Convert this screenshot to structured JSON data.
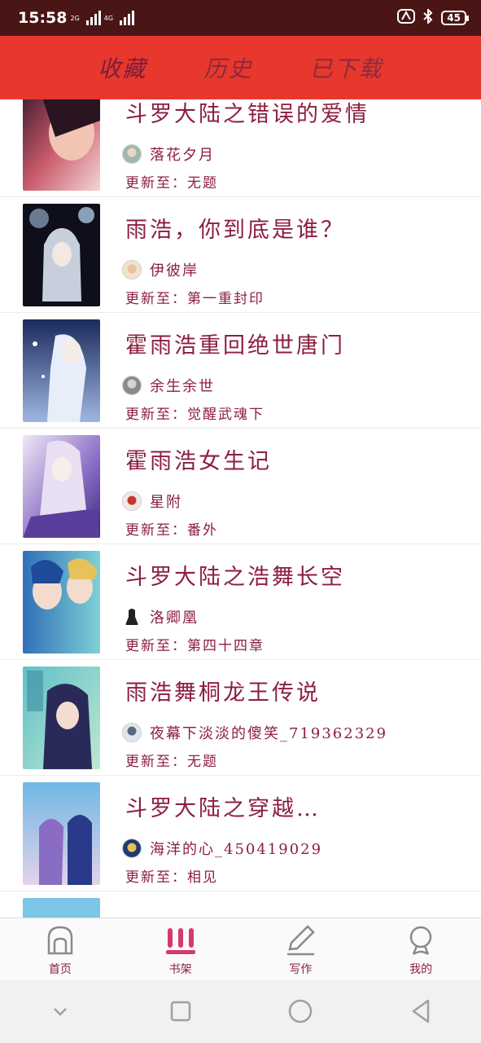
{
  "status_bar": {
    "time": "15:58",
    "network_label_1": "2G",
    "network_label_2": "4G",
    "battery": "45"
  },
  "header": {
    "tabs": [
      {
        "label": "收藏",
        "active": true
      },
      {
        "label": "历史",
        "active": false
      },
      {
        "label": "已下载",
        "active": false
      }
    ]
  },
  "books": [
    {
      "title": "斗罗大陆之错误的爱情",
      "author": "落花夕月",
      "update": "更新至：无题"
    },
    {
      "title": "雨浩，你到底是谁？",
      "author": "伊彼岸",
      "update": "更新至：第一重封印"
    },
    {
      "title": "霍雨浩重回绝世唐门",
      "author": "余生余世",
      "update": "更新至：觉醒武魂下"
    },
    {
      "title": "霍雨浩女生记",
      "author": "星附",
      "update": "更新至：番外"
    },
    {
      "title": "斗罗大陆之浩舞长空",
      "author": "洛卿凰",
      "update": "更新至：第四十四章"
    },
    {
      "title": "雨浩舞桐龙王传说",
      "author": "夜幕下淡淡的傻笑_719362329",
      "update": "更新至：无题"
    },
    {
      "title": "斗罗大陆之穿越…",
      "author": "海洋的心_450419029",
      "update": "更新至：相见"
    }
  ],
  "bottom_nav": [
    {
      "label": "首页",
      "icon": "home-icon"
    },
    {
      "label": "书架",
      "icon": "bookshelf-icon"
    },
    {
      "label": "写作",
      "icon": "pen-icon"
    },
    {
      "label": "我的",
      "icon": "profile-icon"
    }
  ],
  "colors": {
    "header": "#e8372c",
    "status_bar": "#4a1515",
    "text": "#8c1f3f",
    "active_nav": "#d63a6a"
  }
}
